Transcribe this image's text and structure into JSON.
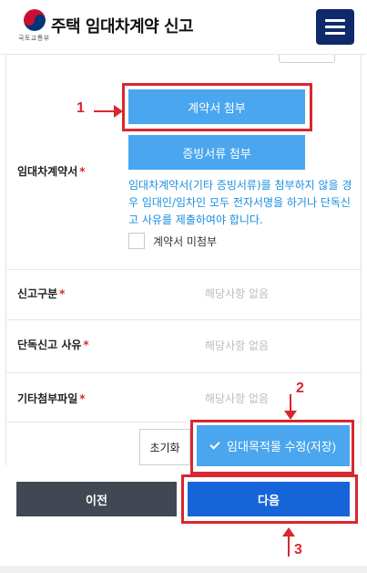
{
  "header": {
    "title": "주택 임대차계약 신고",
    "logo_sub": "국토교통부",
    "logo_icon": "government-emblem-icon",
    "menu_icon": "hamburger-menu-icon",
    "colors": {
      "menu_bg": "#0f2a6b"
    }
  },
  "attach": {
    "contract_button": "계약서 첨부",
    "evidence_button": "증빙서류 첨부"
  },
  "fields": {
    "contract_label": "임대차계약서",
    "required_mark": "*",
    "notice": "임대차계약서(기타 증빙서류)를 첨부하지 않을 경우 임대인/임차인 모두 전자서명을 하거나 단독신고 사유를 제출하여야 합니다.",
    "no_attach_checkbox": "계약서 미첨부",
    "type_label": "신고구분",
    "type_value": "해당사항 없음",
    "reason_label": "단독신고 사유",
    "reason_value": "해당사항 없음",
    "other_label": "기타첨부파일",
    "other_value": "해당사항 없음"
  },
  "actions": {
    "reset": "초기화",
    "save": "임대목적물 수정(저장)",
    "prev": "이전",
    "next": "다음"
  },
  "annotations": {
    "one": "1",
    "two": "2",
    "three": "3"
  },
  "colors": {
    "primary_blue": "#4aa6ee",
    "next_blue": "#1665d8",
    "prev_dark": "#424853",
    "highlight_red": "#d8272f",
    "notice_blue": "#1a8fe0"
  }
}
